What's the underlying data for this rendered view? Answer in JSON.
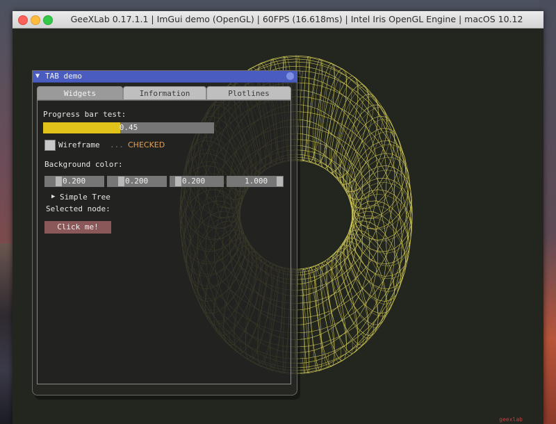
{
  "window": {
    "title": "GeeXLab 0.17.1.1 | ImGui demo (OpenGL) | 60FPS (16.618ms) | Intel Iris OpenGL Engine | macOS 10.12"
  },
  "tab_demo": {
    "title": "TAB demo",
    "tabs": [
      {
        "label": "Widgets",
        "active": true
      },
      {
        "label": "Information",
        "active": false
      },
      {
        "label": "Plotlines",
        "active": false
      }
    ],
    "progress": {
      "label": "Progress bar test:",
      "value": 0.45,
      "value_text": "0.45"
    },
    "wireframe": {
      "label": "Wireframe",
      "state_text": "CHECKED",
      "checked": true
    },
    "background_color": {
      "label": "Background color:",
      "components": [
        0.2,
        0.2,
        0.2,
        1.0
      ],
      "component_texts": [
        "0.200",
        "0.200",
        "0.200",
        "1.000"
      ]
    },
    "tree": {
      "label": "Simple Tree"
    },
    "selected_node": {
      "label": "Selected node:"
    },
    "button": {
      "label": "Click me!"
    }
  },
  "colors": {
    "wire": "#e8e060",
    "title_bar_accent": "#4a5cc0",
    "progress_fill": "#e0c21a",
    "checked_text": "#e8a050",
    "button": "#8a5858"
  },
  "icons": {
    "collapse": "triangle-down",
    "tree_arrow": "triangle-right"
  }
}
